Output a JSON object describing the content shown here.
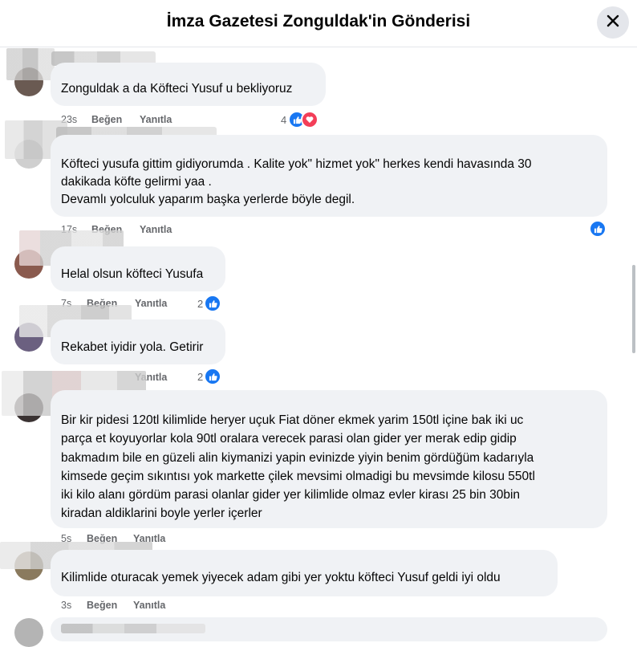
{
  "header": {
    "title": "İmza Gazetesi Zonguldak'in Gönderisi"
  },
  "icons": {
    "close": "close-icon",
    "like": "like-reaction-icon",
    "love": "love-reaction-icon"
  },
  "colors": {
    "accent": "#1877f2",
    "bubble": "#f0f2f5",
    "love": "#f33e58",
    "meta": "#65676b"
  },
  "comments": [
    {
      "text": "Zonguldak a da Köfteci Yusuf u bekliyoruz",
      "time": "23s",
      "like": "Beğen",
      "reply": "Yanıtla",
      "reaction_count": "4"
    },
    {
      "text": "Köfteci yusufa gittim gidiyorumda . Kalite yok\" hizmet yok\" herkes kendi havasında 30\ndakikada köfte gelirmi yaa .\nDevamlı yolculuk yaparım başka yerlerde böyle degil.",
      "time": "17s",
      "like": "Beğen",
      "reply": "Yanıtla",
      "reaction_count": ""
    },
    {
      "text": "Helal olsun köfteci Yusufa",
      "time": "7s",
      "like": "Beğen",
      "reply": "Yanıtla",
      "reaction_count": "2"
    },
    {
      "text": "Rekabet iyidir yola. Getirir",
      "time": "",
      "like": "",
      "reply": "Yanıtla",
      "reaction_count": "2"
    },
    {
      "text": "Bir kir pidesi 120tl kilimlide heryer uçuk Fiat döner ekmek yarim 150tl içine bak iki uc\nparça et koyuyorlar kola 90tl oralara verecek parasi olan gider yer merak edip gidip\nbakmadım bile en güzeli alin kiymanizi yapin evinizde yiyin benim gördüğüm kadarıyla\nkimsede geçim sıkıntısı yok markette çilek mevsimi olmadigi bu mevsimde kilosu 550tl\niki kilo alanı gördüm parasi olanlar gider yer kilimlide olmaz evler kirası 25 bin 30bin\nkiradan aldiklarini boyle yerler içerler",
      "time": "5s",
      "like": "Beğen",
      "reply": "Yanıtla",
      "reaction_count": ""
    },
    {
      "text": "Kilimlide oturacak yemek yiyecek adam gibi yer yoktu köfteci Yusuf geldi iyi oldu",
      "time": "3s",
      "like": "Beğen",
      "reply": "Yanıtla",
      "reaction_count": ""
    }
  ]
}
